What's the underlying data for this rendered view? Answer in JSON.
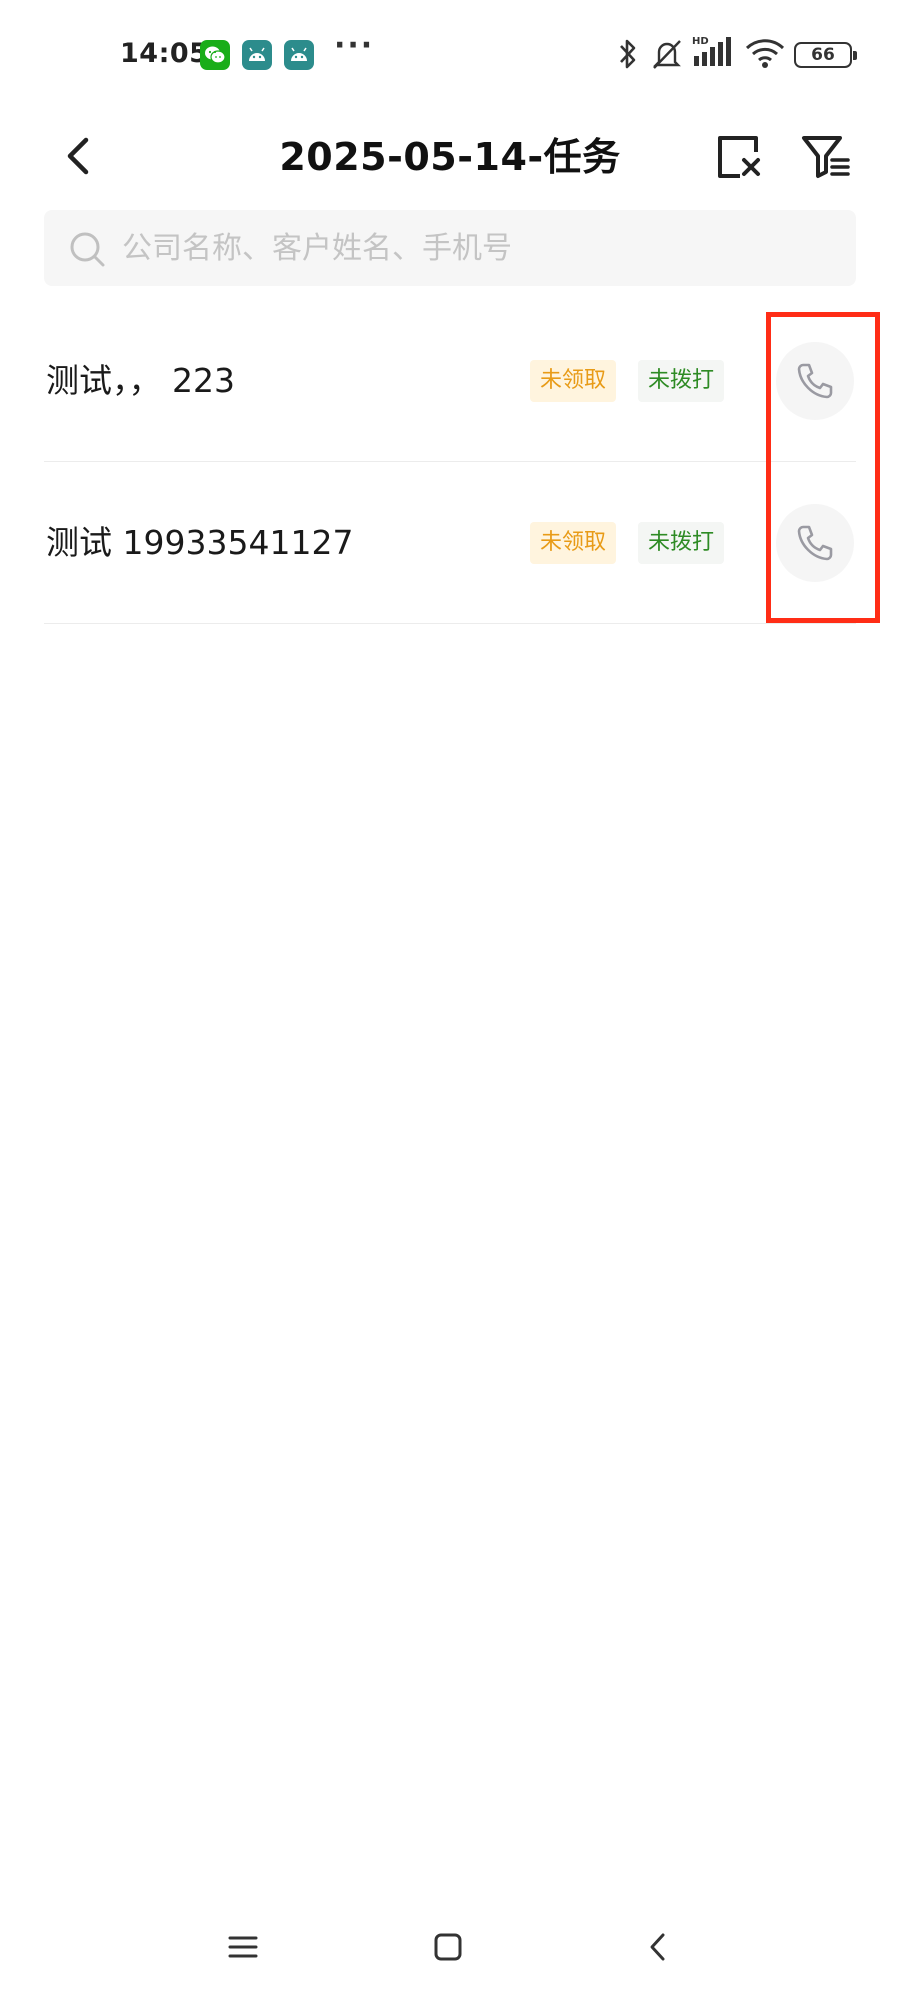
{
  "status_bar": {
    "time": "14:05",
    "battery": "66",
    "network_label": "HD"
  },
  "header": {
    "title": "2025-05-14-任务"
  },
  "search": {
    "placeholder": "公司名称、客户姓名、手机号",
    "value": ""
  },
  "tasks": [
    {
      "name": "测试，， 223",
      "claim_status": "未领取",
      "call_status": "未拨打"
    },
    {
      "name": "测试 19933541127",
      "claim_status": "未领取",
      "call_status": "未拨打"
    }
  ],
  "colors": {
    "unclaimed_text": "#e89b17",
    "unclaimed_bg": "#fff4de",
    "not_dialed_text": "#2e8b24",
    "highlight": "#ff2d16"
  },
  "icons": {
    "back": "chevron-left-icon",
    "clear": "clear-selection-icon",
    "filter": "filter-icon",
    "search": "search-icon",
    "call": "phone-icon"
  }
}
